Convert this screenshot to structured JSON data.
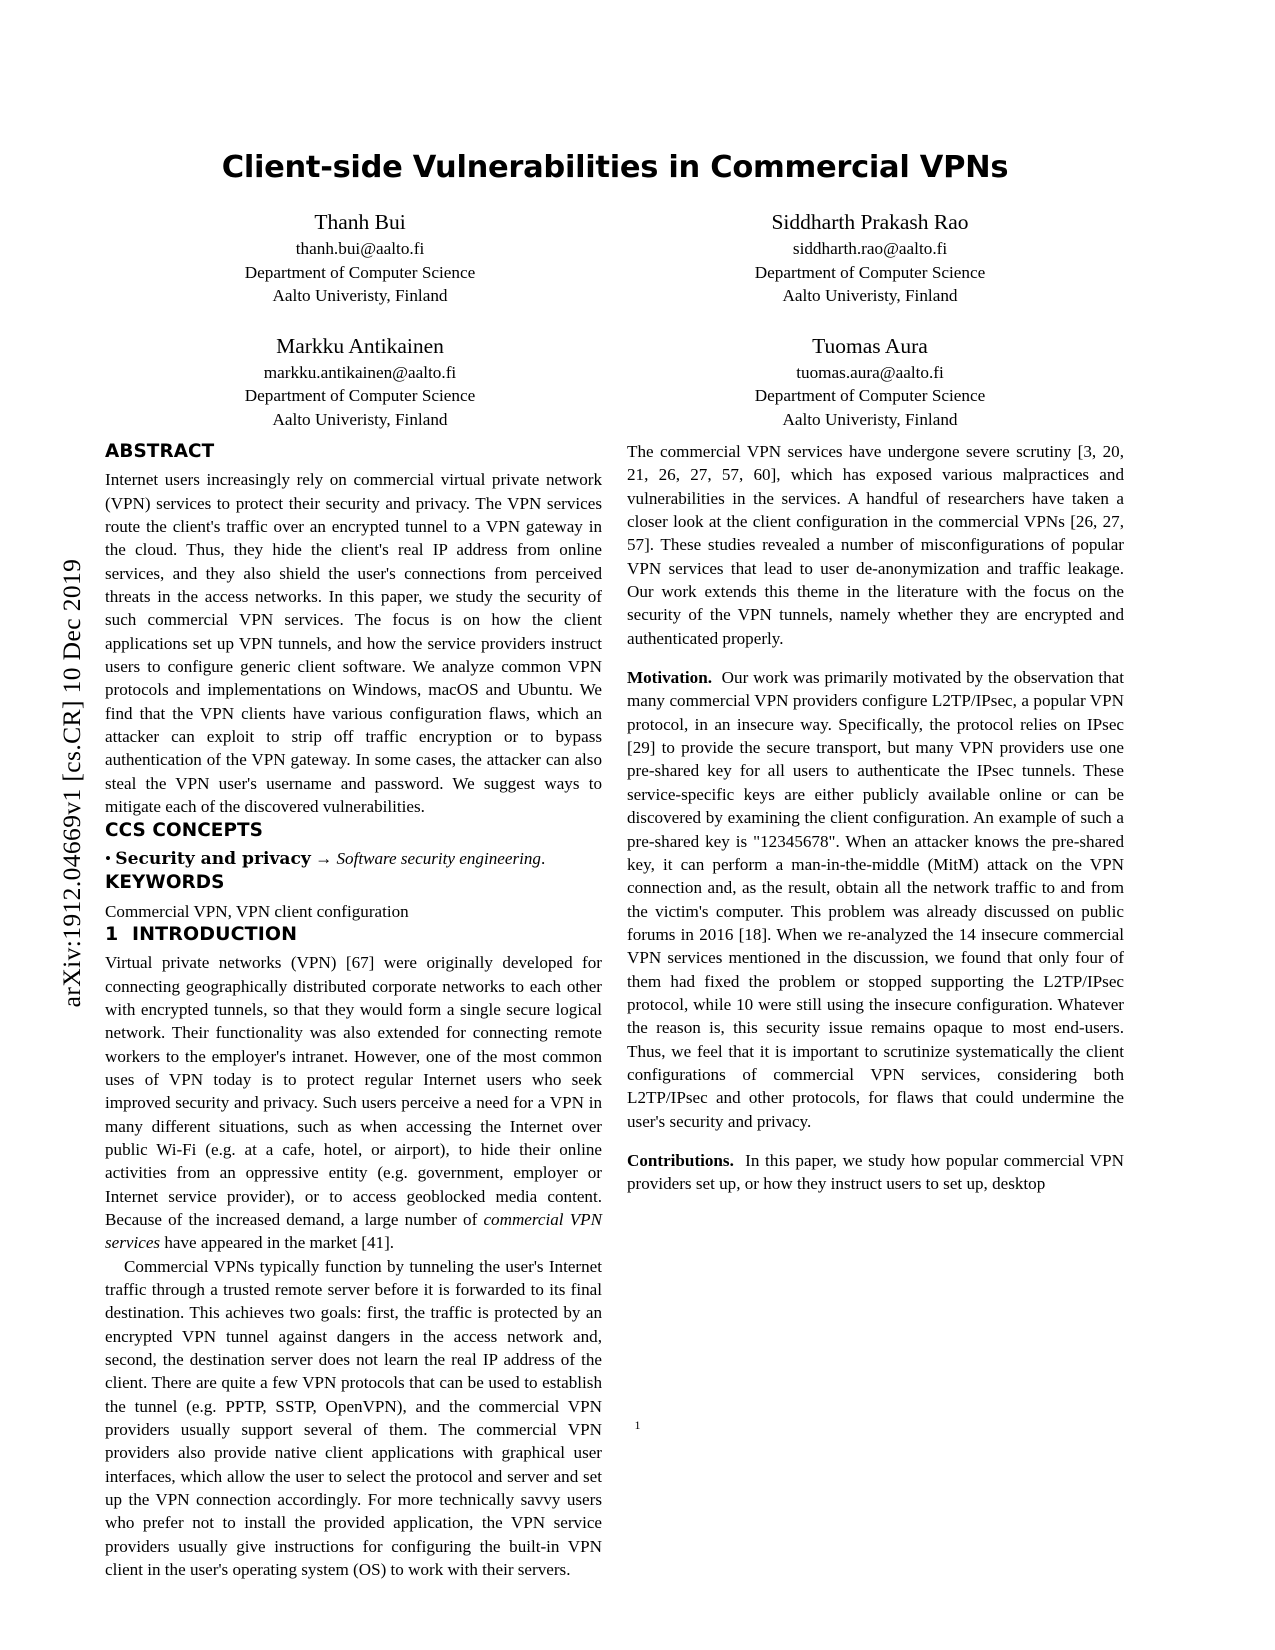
{
  "sidebar": {
    "arxiv_stamp": "arXiv:1912.04669v1  [cs.CR]  10 Dec 2019"
  },
  "paper": {
    "title": "Client-side Vulnerabilities in Commercial VPNs",
    "page_number": "1"
  },
  "authors": [
    {
      "name": "Thanh Bui",
      "email": "thanh.bui@aalto.fi",
      "department": "Department of Computer Science",
      "affiliation": "Aalto Univeristy, Finland"
    },
    {
      "name": "Siddharth Prakash Rao",
      "email": "siddharth.rao@aalto.fi",
      "department": "Department of Computer Science",
      "affiliation": "Aalto Univeristy, Finland"
    },
    {
      "name": "Markku Antikainen",
      "email": "markku.antikainen@aalto.fi",
      "department": "Department of Computer Science",
      "affiliation": "Aalto Univeristy, Finland"
    },
    {
      "name": "Tuomas Aura",
      "email": "tuomas.aura@aalto.fi",
      "department": "Department of Computer Science",
      "affiliation": "Aalto Univeristy, Finland"
    }
  ],
  "sections": {
    "abstract": {
      "heading": "ABSTRACT",
      "text": "Internet users increasingly rely on commercial virtual private network (VPN) services to protect their security and privacy. The VPN services route the client's traffic over an encrypted tunnel to a VPN gateway in the cloud. Thus, they hide the client's real IP address from online services, and they also shield the user's connections from perceived threats in the access networks. In this paper, we study the security of such commercial VPN services. The focus is on how the client applications set up VPN tunnels, and how the service providers instruct users to configure generic client software. We analyze common VPN protocols and implementations on Windows, macOS and Ubuntu. We find that the VPN clients have various configuration flaws, which an attacker can exploit to strip off traffic encryption or to bypass authentication of the VPN gateway. In some cases, the attacker can also steal the VPN user's username and password. We suggest ways to mitigate each of the discovered vulnerabilities."
    },
    "ccs_concepts": {
      "heading": "CCS CONCEPTS",
      "bullet": "•",
      "bold_part": "Security and privacy",
      "arrow": "→",
      "italic_part": "Software security engineering",
      "period": "."
    },
    "keywords": {
      "heading": "KEYWORDS",
      "text": "Commercial VPN, VPN client configuration"
    },
    "introduction": {
      "number": "1",
      "heading": "INTRODUCTION",
      "paragraphs": [
        "Virtual private networks (VPN) [67] were originally developed for connecting geographically distributed corporate networks to each other with encrypted tunnels, so that they would form a single secure logical network. Their functionality was also extended for connecting remote workers to the employer's intranet. However, one of the most common uses of VPN today is to protect regular Internet users who seek improved security and privacy. Such users perceive a need for a VPN in many different situations, such as when accessing the Internet over public Wi-Fi (e.g. at a cafe, hotel, or airport), to hide their online activities from an oppressive entity (e.g. government, employer or Internet service provider), or to access geoblocked media content. Because of the increased demand, a large number of ",
        "Commercial VPNs typically function by tunneling the user's Internet traffic through a trusted remote server before it is forwarded to its final destination. This achieves two goals: first, the traffic is protected by an encrypted VPN tunnel against dangers in the access network and, second, the destination server does not learn the real IP address of the client. There are quite a few VPN protocols that can be used to establish the tunnel (e.g. PPTP, SSTP, OpenVPN), and the commercial VPN providers usually support several of them. The commercial VPN providers also provide native client applications with graphical user interfaces, which allow the user to select the protocol and server and set up the VPN connection accordingly. For more technically savvy users who prefer not to install the provided application, the VPN service providers usually give instructions for configuring the built-in VPN client in the user's operating system (OS) to work with their servers.",
        "The commercial VPN services have undergone severe scrutiny [3, 20, 21, 26, 27, 57, 60], which has exposed various malpractices and vulnerabilities in the services. A handful of researchers have taken a closer look at the client configuration in the commercial VPNs [26, 27, 57]. These studies revealed a number of misconfigurations of popular VPN services that lead to user de-anonymization and traffic leakage. Our work extends this theme in the literature with the focus on the security of the VPN tunnels, namely whether they are encrypted and authenticated properly."
      ],
      "para1_italic": "commercial VPN services",
      "para1_tail": " have appeared in the market [41].",
      "motivation": {
        "lead": "Motivation.",
        "text": "Our work was primarily motivated by the observation that many commercial VPN providers configure L2TP/IPsec, a popular VPN protocol, in an insecure way. Specifically, the protocol relies on IPsec [29] to provide the secure transport, but many VPN providers use one pre-shared key for all users to authenticate the IPsec tunnels. These service-specific keys are either publicly available online or can be discovered by examining the client configuration. An example of such a pre-shared key is \"12345678\". When an attacker knows the pre-shared key, it can perform a man-in-the-middle (MitM) attack on the VPN connection and, as the result, obtain all the network traffic to and from the victim's computer. This problem was already discussed on public forums in 2016 [18]. When we re-analyzed the 14 insecure commercial VPN services mentioned in the discussion, we found that only four of them had fixed the problem or stopped supporting the L2TP/IPsec protocol, while 10 were still using the insecure configuration. Whatever the reason is, this security issue remains opaque to most end-users. Thus, we feel that it is important to scrutinize systematically the client configurations of commercial VPN services, considering both L2TP/IPsec and other protocols, for flaws that could undermine the user's security and privacy."
      },
      "contributions": {
        "lead": "Contributions.",
        "text": "In this paper, we study how popular commercial VPN providers set up, or how they instruct users to set up, desktop"
      }
    }
  }
}
